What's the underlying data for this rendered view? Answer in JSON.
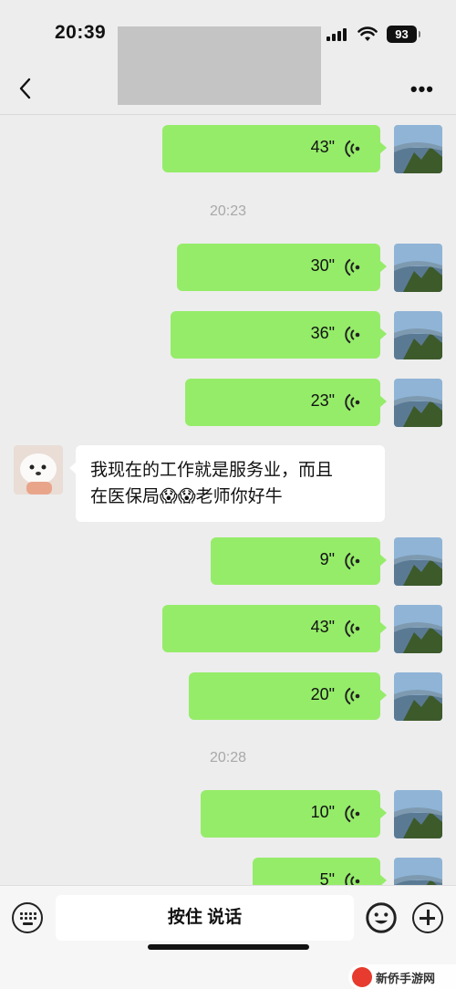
{
  "status_bar": {
    "time": "20:39",
    "battery": "93"
  },
  "nav": {
    "back_icon": "chevron-left-icon",
    "more_label": "•••"
  },
  "timestamps": [
    "20:23",
    "20:28"
  ],
  "voice_messages": [
    "43\"",
    "30\"",
    "36\"",
    "23\"",
    "9\"",
    "43\"",
    "20\"",
    "10\"",
    "5\""
  ],
  "incoming_message": {
    "line1": "我现在的工作就是服务业，而且",
    "line2_before": "在医保局",
    "emoji": "😱😱",
    "line2_after": "老师你好牛"
  },
  "input_bar": {
    "hold_to_talk": "按住 说话",
    "keyboard_icon": "keyboard-icon",
    "emoji_icon": "smiley-icon",
    "plus_icon": "plus-icon"
  },
  "watermark": {
    "text": "新侨手游网"
  },
  "colors": {
    "out_bubble": "#95ec69",
    "background": "#ededed"
  }
}
